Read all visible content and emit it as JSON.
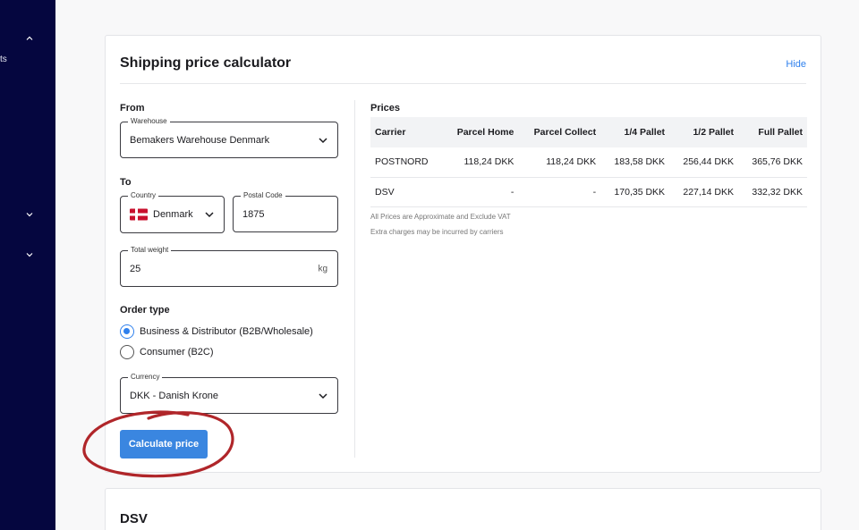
{
  "sidebar": {
    "partial_text": "ts"
  },
  "calculator": {
    "title": "Shipping price calculator",
    "hide_label": "Hide",
    "from_label": "From",
    "warehouse": {
      "legend": "Warehouse",
      "value": "Bemakers Warehouse Denmark"
    },
    "to_label": "To",
    "country": {
      "legend": "Country",
      "value": "Denmark",
      "flag": "denmark-flag-icon"
    },
    "postal_code": {
      "legend": "Postal Code",
      "value": "1875"
    },
    "total_weight": {
      "legend": "Total weight",
      "value": "25",
      "unit": "kg"
    },
    "order_type_label": "Order type",
    "order_types": [
      {
        "label": "Business & Distributor (B2B/Wholesale)",
        "selected": true
      },
      {
        "label": "Consumer (B2C)",
        "selected": false
      }
    ],
    "currency": {
      "legend": "Currency",
      "value": "DKK - Danish Krone"
    },
    "calculate_label": "Calculate price",
    "prices_label": "Prices",
    "table": {
      "headers": [
        "Carrier",
        "Parcel Home",
        "Parcel Collect",
        "1/4 Pallet",
        "1/2 Pallet",
        "Full Pallet"
      ],
      "rows": [
        [
          "POSTNORD",
          "118,24 DKK",
          "118,24 DKK",
          "183,58 DKK",
          "256,44 DKK",
          "365,76 DKK"
        ],
        [
          "DSV",
          "-",
          "-",
          "170,35 DKK",
          "227,14 DKK",
          "332,32 DKK"
        ]
      ]
    },
    "notes": [
      "All Prices are Approximate and Exclude VAT",
      "Extra charges may be incurred by carriers"
    ]
  },
  "carrier_card": {
    "title": "DSV"
  },
  "colors": {
    "sidebar_bg": "#05063f",
    "accent": "#3a86e0",
    "annotation": "#b0262a"
  }
}
